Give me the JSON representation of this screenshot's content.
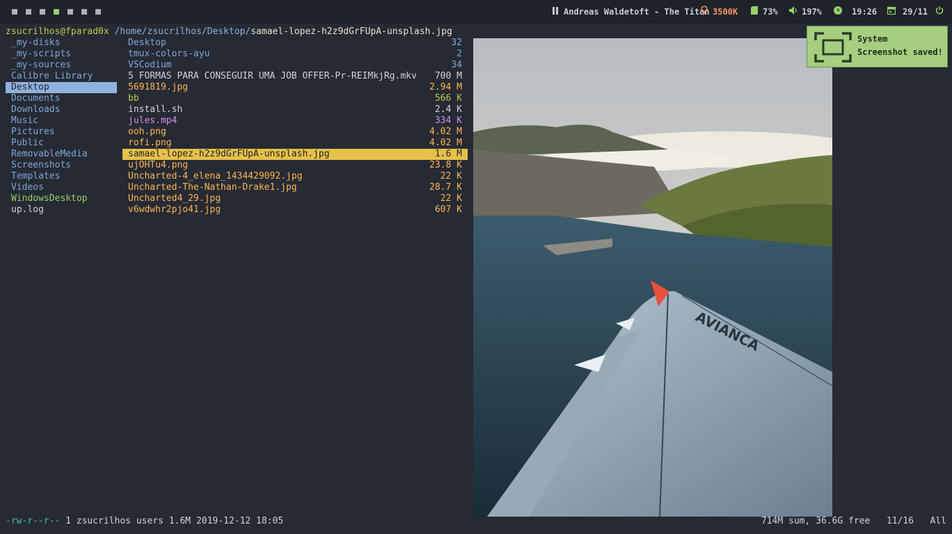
{
  "topbar": {
    "workspaces": [
      {
        "active": false
      },
      {
        "active": false
      },
      {
        "active": false
      },
      {
        "active": true
      },
      {
        "active": false
      },
      {
        "active": false
      },
      {
        "active": false
      }
    ],
    "music": "Andreas Waldetoft - The Titan",
    "memory": "3500K",
    "disk": "73%",
    "volume": "197%",
    "time": "19:26",
    "date": "29/11",
    "icons": {
      "music": "pause-icon",
      "memory": "lightbulb-icon",
      "disk": "sd-card-icon",
      "volume": "speaker-icon",
      "time": "clock-icon",
      "date": "calendar-icon",
      "power": "power-icon"
    },
    "colors": {
      "memory": "#f29668",
      "accent": "#95d16a"
    }
  },
  "path": {
    "host": "zsucrilhos@fparad0x",
    "dir": "/home/zsucrilhos/Desktop/",
    "file": "samael-lopez-h2z9dGrFUpA-unsplash.jpg"
  },
  "parent_entries": [
    {
      "name": "_my-disks",
      "type": "dir"
    },
    {
      "name": "_my-scripts",
      "type": "dir"
    },
    {
      "name": "_my-sources",
      "type": "dir"
    },
    {
      "name": "Calibre Library",
      "type": "dir"
    },
    {
      "name": "Desktop",
      "type": "dir",
      "selected": true
    },
    {
      "name": "Documents",
      "type": "dir"
    },
    {
      "name": "Downloads",
      "type": "dir"
    },
    {
      "name": "Music",
      "type": "dir"
    },
    {
      "name": "Pictures",
      "type": "dir"
    },
    {
      "name": "Public",
      "type": "dir"
    },
    {
      "name": "RemovableMedia",
      "type": "dir"
    },
    {
      "name": "Screenshots",
      "type": "dir"
    },
    {
      "name": "Templates",
      "type": "dir"
    },
    {
      "name": "Videos",
      "type": "dir"
    },
    {
      "name": "WindowsDesktop",
      "type": "green"
    },
    {
      "name": "up.log",
      "type": "file"
    }
  ],
  "entries": [
    {
      "name": "Desktop",
      "size": "32",
      "type": "dir"
    },
    {
      "name": "tmux-colors-ayu",
      "size": "2",
      "type": "dir"
    },
    {
      "name": "VSCodium",
      "size": "34",
      "type": "dir"
    },
    {
      "name": "5 FORMAS PARA CONSEGUIR UMA JOB OFFER-Pr-REIMkjRg.mkv",
      "size": "700 M",
      "type": "file"
    },
    {
      "name": "5691819.jpg",
      "size": "2.94 M",
      "type": "img"
    },
    {
      "name": "bb",
      "size": "566 K",
      "type": "exec"
    },
    {
      "name": "install.sh",
      "size": "2.4 K",
      "type": "file"
    },
    {
      "name": "jules.mp4",
      "size": "334 K",
      "type": "vid"
    },
    {
      "name": "ooh.png",
      "size": "4.02 M",
      "type": "img"
    },
    {
      "name": "rofi.png",
      "size": "4.02 M",
      "type": "img"
    },
    {
      "name": "samael-lopez-h2z9dGrFUpA-unsplash.jpg",
      "size": "1.6 M",
      "type": "img",
      "selected": true
    },
    {
      "name": "ujOHTu4.png",
      "size": "23.8 K",
      "type": "img"
    },
    {
      "name": "Uncharted-4_elena_1434429092.jpg",
      "size": "22 K",
      "type": "img"
    },
    {
      "name": "Uncharted-The-Nathan-Drake1.jpg",
      "size": "28.7 K",
      "type": "img"
    },
    {
      "name": "Uncharted4_29.jpg",
      "size": "22 K",
      "type": "img"
    },
    {
      "name": "v6wdwhr2pjo41.jpg",
      "size": "607 K",
      "type": "img"
    }
  ],
  "preview": {
    "wing_text": "AVIANCA",
    "icon": "airplane-wing-photo"
  },
  "notification": {
    "title": "System",
    "message": "Screenshot saved!",
    "icon": "screenshot-icon"
  },
  "status": {
    "perms": "-rw-r--r--",
    "info": "1 zsucrilhos users 1.6M 2019-12-12 18:05",
    "summary": "714M sum, 36.6G free",
    "position": "11/16",
    "scroll": "All"
  }
}
